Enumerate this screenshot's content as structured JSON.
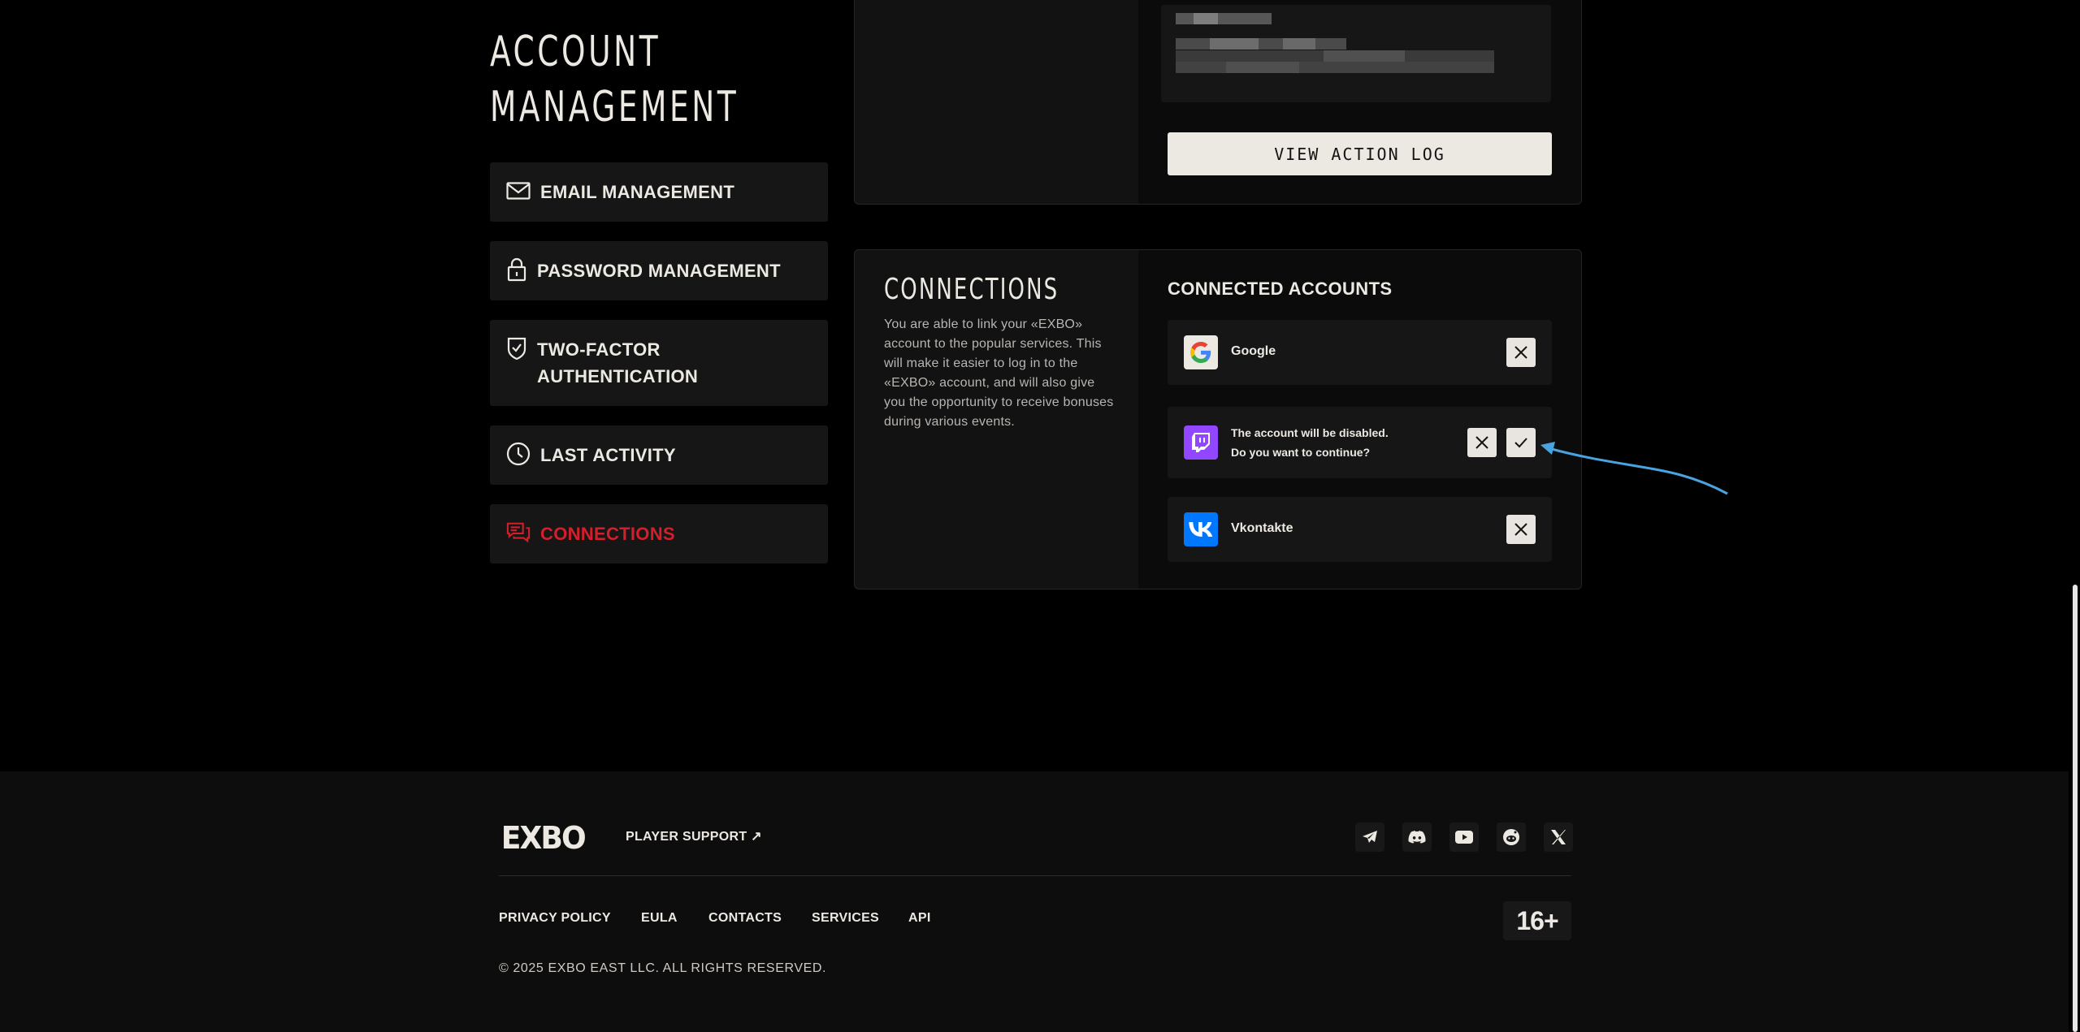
{
  "page": {
    "title_line1": "ACCOUNT",
    "title_line2": "MANAGEMENT"
  },
  "sidebar": {
    "items": [
      {
        "label": "EMAIL MANAGEMENT",
        "icon": "envelope-icon"
      },
      {
        "label": "PASSWORD MANAGEMENT",
        "icon": "lock-icon"
      },
      {
        "label_line1": "TWO-FACTOR",
        "label_line2": "AUTHENTICATION",
        "icon": "shield-check-icon"
      },
      {
        "label": "LAST ACTIVITY",
        "icon": "clock-icon"
      },
      {
        "label": "CONNECTIONS",
        "icon": "chat-icon",
        "active": true
      }
    ]
  },
  "activity": {
    "view_log_label": "VIEW ACTION LOG"
  },
  "connections": {
    "title": "CONNECTIONS",
    "description": "You are able to link your «EXBO» account to the popular services. This will make it easier to log in to the «EXBO» account, and will also give you the opportunity to receive bonuses during various events.",
    "connected_heading": "CONNECTED ACCOUNTS",
    "accounts": [
      {
        "name": "Google",
        "icon": "google-icon"
      },
      {
        "confirm_line1": "The account will be disabled.",
        "confirm_line2": "Do you want to continue?",
        "icon": "twitch-icon"
      },
      {
        "name": "Vkontakte",
        "icon": "vk-icon"
      }
    ]
  },
  "footer": {
    "logo": "EXBO",
    "player_support": "PLAYER SUPPORT ↗",
    "social": [
      "telegram-icon",
      "discord-icon",
      "youtube-icon",
      "reddit-icon",
      "x-icon"
    ],
    "links": [
      "PRIVACY POLICY",
      "EULA",
      "CONTACTS",
      "SERVICES",
      "API"
    ],
    "age_rating": "16+",
    "copyright": "© 2025 EXBO EAST LLC. ALL RIGHTS RESERVED."
  },
  "colors": {
    "accent": "#d11f2b",
    "twitch": "#9146ff",
    "vk": "#0077ff",
    "annotation_arrow": "#4aa3df"
  }
}
